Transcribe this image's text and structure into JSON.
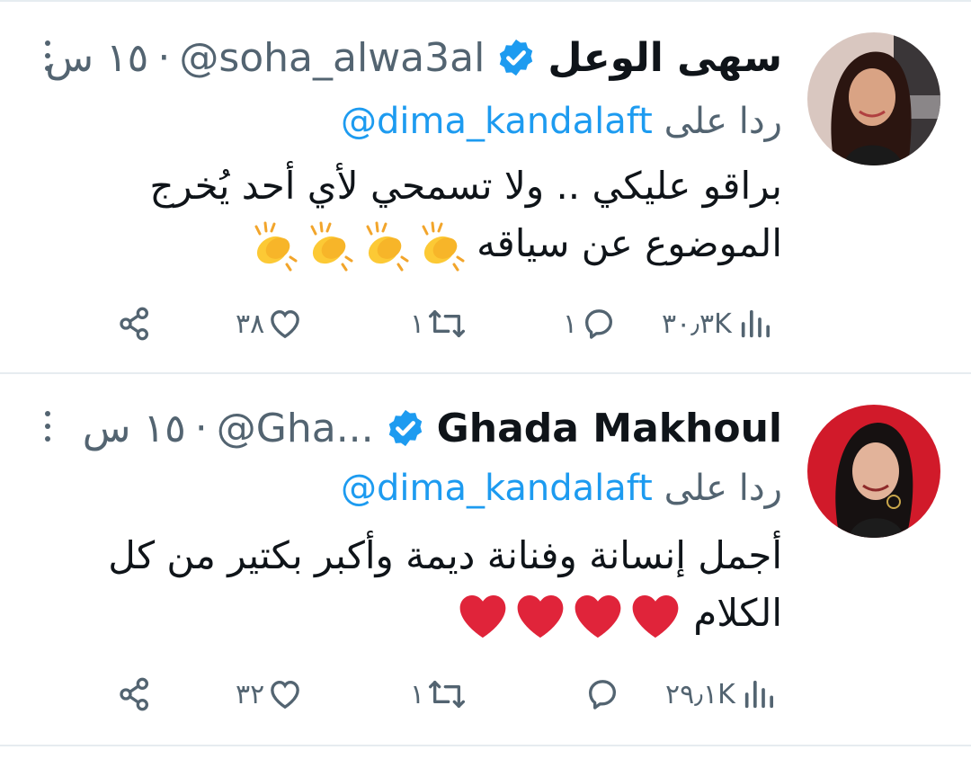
{
  "tweets": [
    {
      "display_name": "سهى الوعل",
      "handle": "@soha_alwa3al",
      "separator": "·",
      "time": "١٥ س",
      "reply_prefix": "ردا على",
      "reply_mention": "@dima_kandalaft",
      "text_line1": "براقو عليكي .. ولا تسمحي لأي أحد يُخرج",
      "text_line2": "الموضوع عن سياقه",
      "emoji": "clapping-hands",
      "emoji_count": 4,
      "views": "٣٠٫٣K",
      "replies": "١",
      "retweets": "١",
      "likes": "٣٨"
    },
    {
      "display_name": "Ghada Makhoul",
      "handle": "@Gha...",
      "separator": "·",
      "time": "١٥ س",
      "reply_prefix": "ردا على",
      "reply_mention": "@dima_kandalaft",
      "text_line1": "أجمل إنسانة وفنانة ديمة وأكبر بكتير من كل",
      "text_line2": "الكلام",
      "emoji": "red-heart",
      "emoji_count": 4,
      "views": "٢٩٫١K",
      "replies": "",
      "retweets": "١",
      "likes": "٣٢"
    }
  ],
  "colors": {
    "accent": "#1d9bf0",
    "muted": "#536471",
    "text": "#0f1419",
    "heart": "#e0243a",
    "divider": "#e6ecf0"
  },
  "icons": [
    "more-icon",
    "verified-badge-icon",
    "share-icon",
    "like-icon",
    "retweet-icon",
    "reply-icon",
    "views-icon"
  ]
}
